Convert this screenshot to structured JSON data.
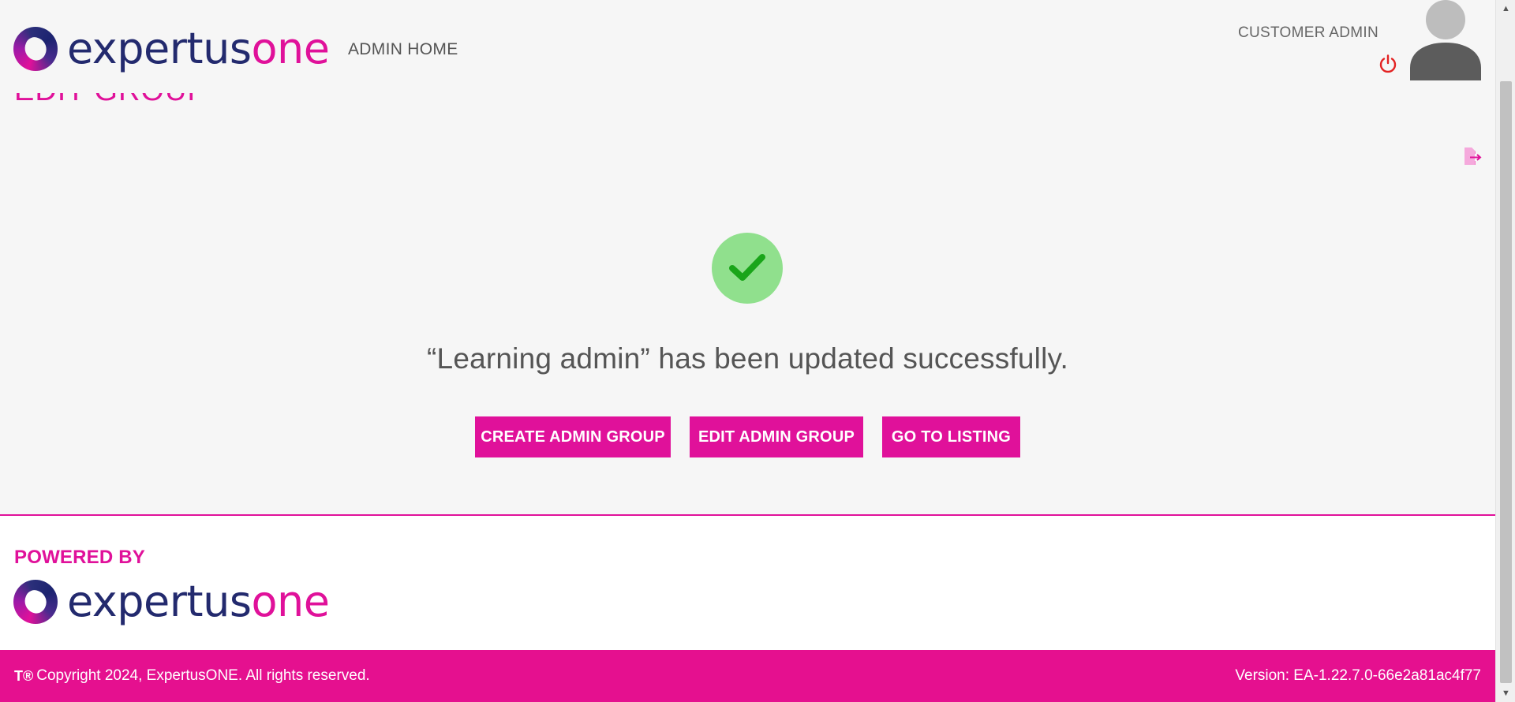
{
  "brand": {
    "name_part1": "expertus",
    "name_part2": "one",
    "primary_color": "#e0119a",
    "dark_color": "#232a6e"
  },
  "header": {
    "nav_home": "ADMIN HOME",
    "user_role": "CUSTOMER ADMIN",
    "icons": [
      "logo-ring-icon",
      "power-icon",
      "avatar-icon"
    ]
  },
  "page": {
    "title": "EDIT GROUP"
  },
  "success": {
    "message": "“Learning admin” has been updated successfully.",
    "check_color": "#90e08d"
  },
  "actions": {
    "create": "CREATE ADMIN GROUP",
    "edit": "EDIT ADMIN GROUP",
    "listing": "GO TO LISTING"
  },
  "footer": {
    "powered_by": "POWERED BY",
    "tm": "T®",
    "copyright": "Copyright 2024, ExpertusONE. All rights reserved.",
    "version": "Version: EA-1.22.7.0-66e2a81ac4f77"
  },
  "scrollbar": {
    "up": "▲",
    "down": "▼"
  }
}
